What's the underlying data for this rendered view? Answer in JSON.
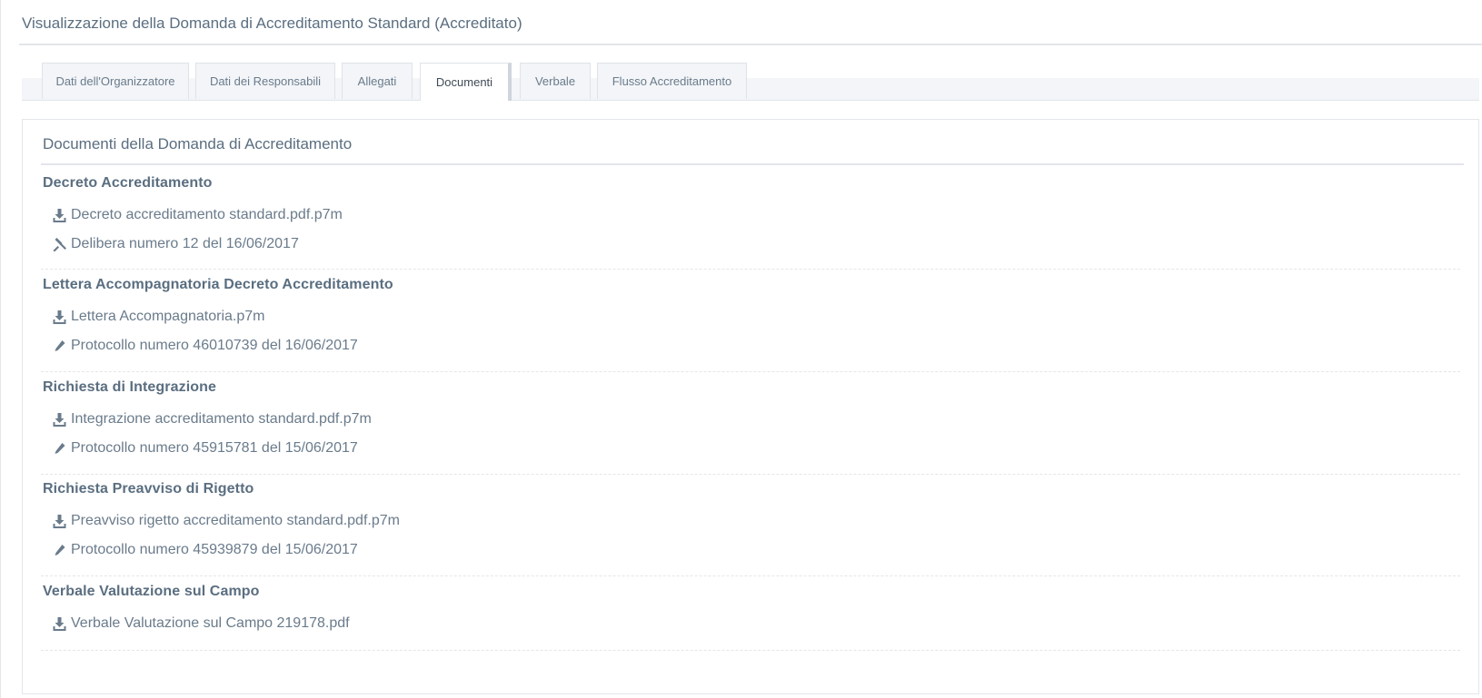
{
  "page": {
    "title": "Visualizzazione della Domanda di Accreditamento Standard (Accreditato)"
  },
  "tabs": [
    {
      "label": "Dati dell'Organizzatore",
      "active": false
    },
    {
      "label": "Dati dei Responsabili",
      "active": false
    },
    {
      "label": "Allegati",
      "active": false
    },
    {
      "label": "Documenti",
      "active": true
    },
    {
      "label": "Verbale",
      "active": false
    },
    {
      "label": "Flusso Accreditamento",
      "active": false
    }
  ],
  "panel": {
    "title": "Documenti della Domanda di Accreditamento",
    "sections": [
      {
        "title": "Decreto Accreditamento",
        "file": {
          "icon": "download-icon",
          "label": "Decreto accreditamento standard.pdf.p7m"
        },
        "meta": {
          "icon": "gavel-icon",
          "label": "Delibera numero 12 del 16/06/2017"
        }
      },
      {
        "title": "Lettera Accompagnatoria Decreto Accreditamento",
        "file": {
          "icon": "download-icon",
          "label": "Lettera Accompagnatoria.p7m"
        },
        "meta": {
          "icon": "pencil-icon",
          "label": "Protocollo numero 46010739 del 16/06/2017"
        }
      },
      {
        "title": "Richiesta di Integrazione",
        "file": {
          "icon": "download-icon",
          "label": "Integrazione accreditamento standard.pdf.p7m"
        },
        "meta": {
          "icon": "pencil-icon",
          "label": "Protocollo numero 45915781 del 15/06/2017"
        }
      },
      {
        "title": "Richiesta Preavviso di Rigetto",
        "file": {
          "icon": "download-icon",
          "label": "Preavviso rigetto accreditamento standard.pdf.p7m"
        },
        "meta": {
          "icon": "pencil-icon",
          "label": "Protocollo numero 45939879 del 15/06/2017"
        }
      },
      {
        "title": "Verbale Valutazione sul Campo",
        "file": {
          "icon": "download-icon",
          "label": "Verbale Valutazione sul Campo 219178.pdf"
        }
      }
    ]
  }
}
